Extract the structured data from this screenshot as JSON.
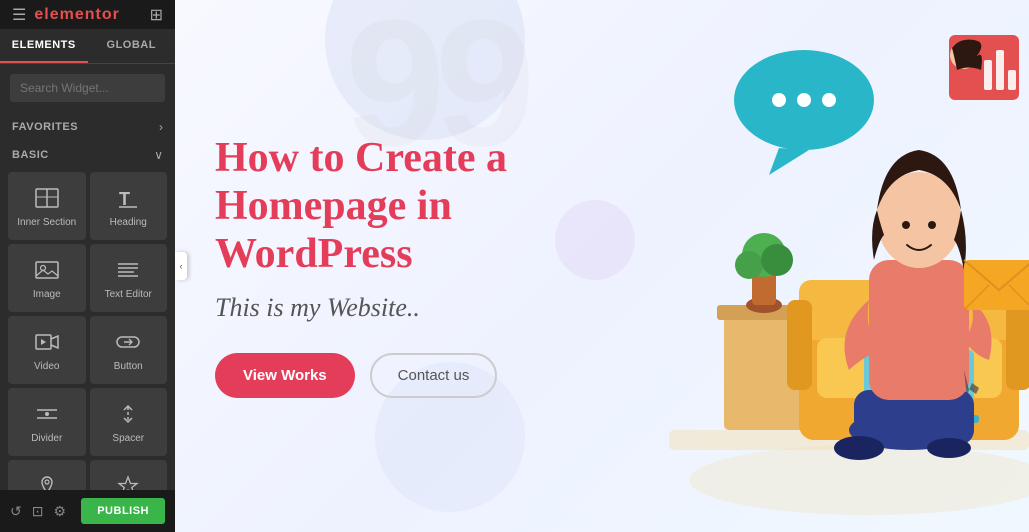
{
  "sidebar": {
    "logo": "elementor",
    "tabs": [
      {
        "label": "ELEMENTS",
        "active": true
      },
      {
        "label": "GLOBAL",
        "active": false
      }
    ],
    "search_placeholder": "Search Widget...",
    "favorites_label": "FAVORITES",
    "basic_label": "BASIC",
    "widgets": [
      {
        "id": "inner-section",
        "label": "Inner Section",
        "icon": "inner-section-icon"
      },
      {
        "id": "heading",
        "label": "Heading",
        "icon": "heading-icon"
      },
      {
        "id": "image",
        "label": "Image",
        "icon": "image-icon"
      },
      {
        "id": "text-editor",
        "label": "Text Editor",
        "icon": "text-editor-icon"
      },
      {
        "id": "video",
        "label": "Video",
        "icon": "video-icon"
      },
      {
        "id": "button",
        "label": "Button",
        "icon": "button-icon"
      },
      {
        "id": "divider",
        "label": "Divider",
        "icon": "divider-icon"
      },
      {
        "id": "spacer",
        "label": "Spacer",
        "icon": "spacer-icon"
      },
      {
        "id": "google-maps",
        "label": "Google Maps",
        "icon": "map-icon"
      },
      {
        "id": "icon",
        "label": "Icon",
        "icon": "icon-icon"
      }
    ],
    "publish_label": "PUBLISH",
    "collapse_arrow": "‹"
  },
  "hero": {
    "title": "How to Create a Homepage in WordPress",
    "subtitle": "This is my Website..",
    "btn_primary": "View Works",
    "btn_secondary": "Contact us"
  },
  "colors": {
    "red": "#e43d5a",
    "green": "#39b54a",
    "sidebar_bg": "#2c2c2c",
    "header_bg": "#1a1a1a",
    "widget_bg": "#3d3d3d"
  }
}
